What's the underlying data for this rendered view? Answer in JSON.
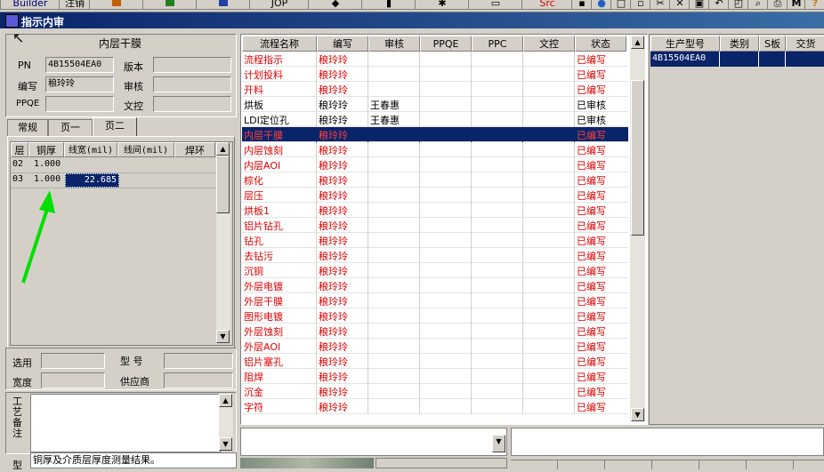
{
  "toolbar": {
    "builder_label": "Builder",
    "logout_label": "注销",
    "jop_label": "JOP",
    "src_label": "Src"
  },
  "window": {
    "title": "指示内审"
  },
  "left": {
    "title": "内层干膜",
    "pn_label": "PN",
    "pn_value": "4B15504EA0",
    "version_label": "版本",
    "version_value": "",
    "author_label": "编写",
    "author_value": "稂玲玲",
    "review_label": "审核",
    "review_value": "",
    "ppqe_label": "PPQE",
    "ppqe_value": "",
    "control_label": "文控",
    "control_value": "",
    "tabs": [
      "常规",
      "页一",
      "页二"
    ],
    "layer_grid": {
      "headers": [
        "层",
        "铜厚",
        "线宽(mil)",
        "线间(mil)",
        "焊环"
      ],
      "rows": [
        [
          "02",
          "1.000",
          "",
          "",
          ""
        ],
        [
          "03",
          "1.000",
          "22.685",
          "",
          ""
        ]
      ]
    },
    "select_label": "选用",
    "model_label": "型 号",
    "width_label": "宽度",
    "supplier_label": "供应商",
    "remark_label": "工艺备注",
    "note_text": "铜厚及介质层厚度测量结果。",
    "bottom_label": "型"
  },
  "flow": {
    "headers": [
      "流程名称",
      "编写",
      "审核",
      "PPQE",
      "PPC",
      "文控",
      "状态"
    ],
    "rows": [
      {
        "name": "流程指示",
        "author": "稂玲玲",
        "reviewer": "",
        "status": "已编写",
        "red": true
      },
      {
        "name": "计划投料",
        "author": "稂玲玲",
        "reviewer": "",
        "status": "已编写",
        "red": true
      },
      {
        "name": "开料",
        "author": "稂玲玲",
        "reviewer": "",
        "status": "已编写",
        "red": true
      },
      {
        "name": "烘板",
        "author": "稂玲玲",
        "reviewer": "王春惠",
        "status": "已审核",
        "red": false
      },
      {
        "name": "LDI定位孔",
        "author": "稂玲玲",
        "reviewer": "王春惠",
        "status": "已审核",
        "red": false
      },
      {
        "name": "内层干膜",
        "author": "稂玲玲",
        "reviewer": "",
        "status": "已编写",
        "red": true,
        "selected": true
      },
      {
        "name": "内层蚀刻",
        "author": "稂玲玲",
        "reviewer": "",
        "status": "已编写",
        "red": true
      },
      {
        "name": "内层AOI",
        "author": "稂玲玲",
        "reviewer": "",
        "status": "已编写",
        "red": true
      },
      {
        "name": "棕化",
        "author": "稂玲玲",
        "reviewer": "",
        "status": "已编写",
        "red": true
      },
      {
        "name": "层压",
        "author": "稂玲玲",
        "reviewer": "",
        "status": "已编写",
        "red": true
      },
      {
        "name": "烘板1",
        "author": "稂玲玲",
        "reviewer": "",
        "status": "已编写",
        "red": true
      },
      {
        "name": "铝片钻孔",
        "author": "稂玲玲",
        "reviewer": "",
        "status": "已编写",
        "red": true
      },
      {
        "name": "钻孔",
        "author": "稂玲玲",
        "reviewer": "",
        "status": "已编写",
        "red": true
      },
      {
        "name": "去钻污",
        "author": "稂玲玲",
        "reviewer": "",
        "status": "已编写",
        "red": true
      },
      {
        "name": "沉铜",
        "author": "稂玲玲",
        "reviewer": "",
        "status": "已编写",
        "red": true
      },
      {
        "name": "外层电镀",
        "author": "稂玲玲",
        "reviewer": "",
        "status": "已编写",
        "red": true
      },
      {
        "name": "外层干膜",
        "author": "稂玲玲",
        "reviewer": "",
        "status": "已编写",
        "red": true
      },
      {
        "name": "图形电镀",
        "author": "稂玲玲",
        "reviewer": "",
        "status": "已编写",
        "red": true
      },
      {
        "name": "外层蚀刻",
        "author": "稂玲玲",
        "reviewer": "",
        "status": "已编写",
        "red": true
      },
      {
        "name": "外层AOI",
        "author": "稂玲玲",
        "reviewer": "",
        "status": "已编写",
        "red": true
      },
      {
        "name": "铝片塞孔",
        "author": "稂玲玲",
        "reviewer": "",
        "status": "已编写",
        "red": true
      },
      {
        "name": "阻焊",
        "author": "稂玲玲",
        "reviewer": "",
        "status": "已编写",
        "red": true
      },
      {
        "name": "沉金",
        "author": "稂玲玲",
        "reviewer": "",
        "status": "已编写",
        "red": true
      },
      {
        "name": "字符",
        "author": "稂玲玲",
        "reviewer": "",
        "status": "已编写",
        "red": true
      }
    ]
  },
  "right": {
    "headers": [
      "生产型号",
      "类别",
      "S板",
      "交货"
    ],
    "rows": [
      [
        "4B15504EA0",
        "",
        "",
        ""
      ]
    ]
  }
}
